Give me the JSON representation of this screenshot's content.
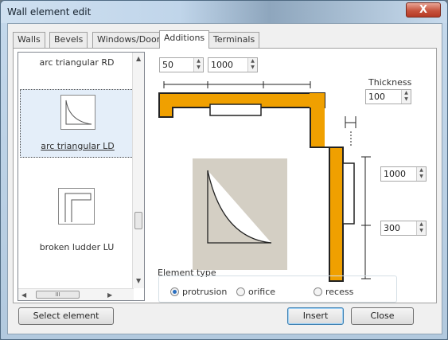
{
  "window": {
    "title": "Wall element edit",
    "close_glyph": "X"
  },
  "tabs": [
    "Walls",
    "Bevels",
    "Windows/Doors",
    "Additions",
    "Terminals"
  ],
  "active_tab": "Additions",
  "elements": [
    {
      "label": "arc triangular RD",
      "icon": "arc-triangular-rd-icon"
    },
    {
      "label": "arc triangular LD",
      "icon": "arc-triangular-ld-icon",
      "selected": true
    },
    {
      "label": "broken ludder LU",
      "icon": "broken-ludder-lu-icon"
    }
  ],
  "scroll": {
    "h_thumb_glyph": "III"
  },
  "dims": {
    "offset": "50",
    "length": "1000"
  },
  "thickness": {
    "label": "Thickness",
    "value": "100"
  },
  "right_dims": {
    "top": "1000",
    "bottom": "300"
  },
  "element_type": {
    "label": "Element type",
    "options": [
      "protrusion",
      "orifice",
      "recess"
    ],
    "selected": "protrusion"
  },
  "buttons": {
    "select_element": "Select element",
    "insert": "Insert",
    "close": "Close"
  },
  "colors": {
    "wall": "#f0a000",
    "preview_bg": "#d4cfc4"
  }
}
